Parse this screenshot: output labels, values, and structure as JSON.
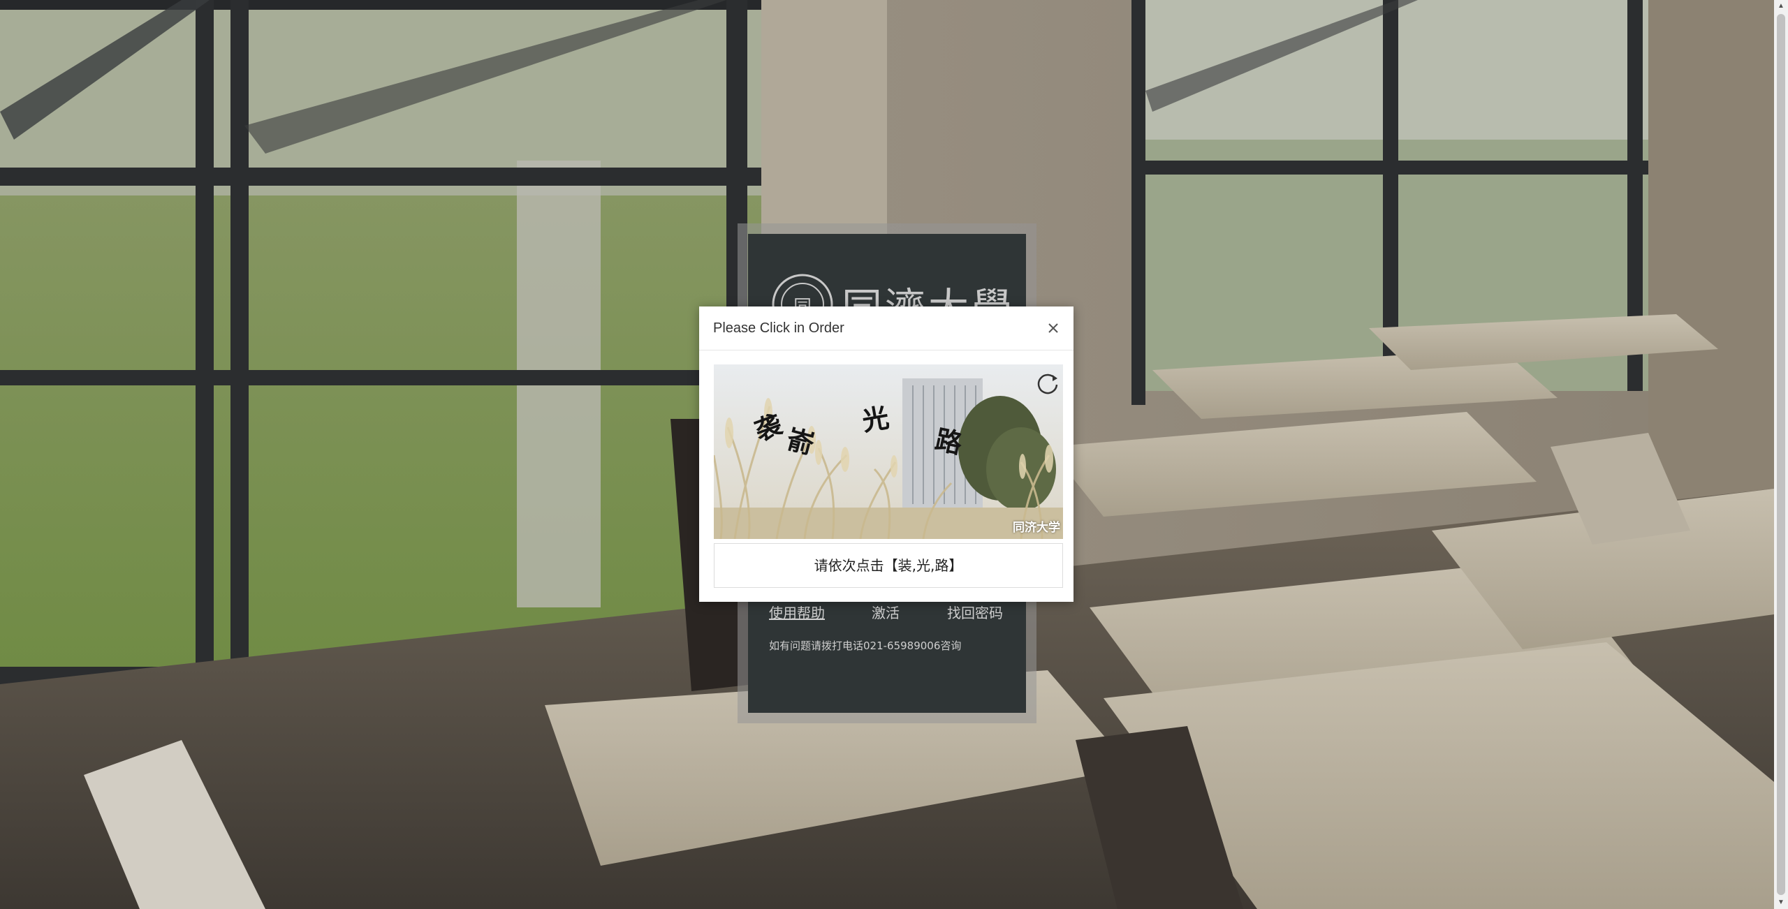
{
  "modal": {
    "title": "Please Click in Order",
    "instruction": "请依次点击【装,光,路】",
    "captcha": {
      "chars": [
        "袭",
        "嵛",
        "光",
        "路"
      ],
      "watermark": "同济大学"
    },
    "icons": {
      "close": "close-icon",
      "refresh": "refresh-icon"
    }
  },
  "login": {
    "logo_text": "同濟大學",
    "links": {
      "help": "使用帮助",
      "activate": "激活",
      "recover": "找回密码"
    },
    "note": "如有问题请拨打电话021-65989006咨询"
  },
  "colors": {
    "panel": "#2f3536",
    "modal_bg": "#ffffff",
    "link_text": "#cfcfcf"
  }
}
